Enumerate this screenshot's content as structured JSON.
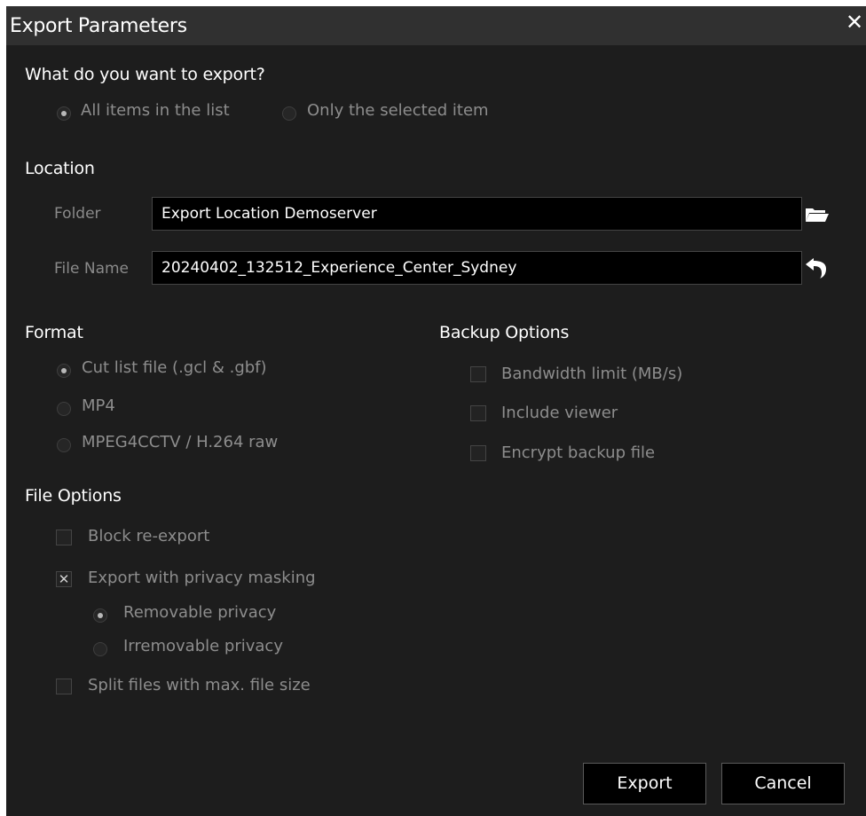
{
  "window": {
    "title": "Export Parameters",
    "close_glyph": "✕"
  },
  "what_section": {
    "heading": "What do you want to export?",
    "options": [
      {
        "label": "All items in the list",
        "selected": true
      },
      {
        "label": "Only the selected item",
        "selected": false
      }
    ]
  },
  "location": {
    "heading": "Location",
    "folder_label": "Folder",
    "folder_value": "Export Location Demoserver",
    "folder_icon": "folder-open-icon",
    "filename_label": "File Name",
    "filename_value": "20240402_132512_Experience_Center_Sydney",
    "filename_icon": "undo-icon"
  },
  "format": {
    "heading": "Format",
    "options": [
      {
        "label": "Cut list file (.gcl & .gbf)",
        "selected": true
      },
      {
        "label": "MP4",
        "selected": false
      },
      {
        "label": "MPEG4CCTV / H.264 raw",
        "selected": false
      }
    ]
  },
  "backup": {
    "heading": "Backup Options",
    "options": [
      {
        "label": "Bandwidth limit (MB/s)",
        "checked": false
      },
      {
        "label": "Include viewer",
        "checked": false
      },
      {
        "label": "Encrypt backup file",
        "checked": false
      }
    ]
  },
  "file_options": {
    "heading": "File Options",
    "block_reexport": {
      "label": "Block re-export",
      "checked": false
    },
    "privacy_masking": {
      "label": "Export with privacy masking",
      "checked": true,
      "mark": "✕"
    },
    "privacy_modes": [
      {
        "label": "Removable privacy",
        "selected": true
      },
      {
        "label": "Irremovable privacy",
        "selected": false
      }
    ],
    "split_files": {
      "label": "Split files with max. file size",
      "checked": false
    }
  },
  "buttons": {
    "export": "Export",
    "cancel": "Cancel"
  },
  "colors": {
    "background": "#1d1d1d",
    "titlebar": "#303030",
    "field_bg": "#000000",
    "muted_text": "#8d8d8d"
  }
}
